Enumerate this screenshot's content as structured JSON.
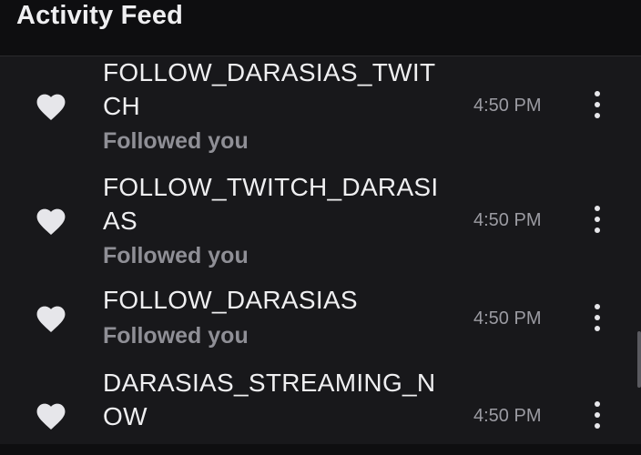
{
  "header": {
    "title": "Activity Feed"
  },
  "icons": {
    "item_icon": "heart-icon",
    "menu_icon": "more-vertical-icon"
  },
  "colors": {
    "background": "#18181b",
    "header_background": "#0e0e10",
    "primary_text": "#efeff1",
    "secondary_text": "#8f8f96",
    "icon": "#e6e6ea"
  },
  "items": [
    {
      "username": "FOLLOW_DARASIAS_TWITCH",
      "subtext": "Followed you",
      "time": "4:50 PM"
    },
    {
      "username": "FOLLOW_TWITCH_DARASIAS",
      "subtext": "Followed you",
      "time": "4:50 PM"
    },
    {
      "username": "FOLLOW_DARASIAS",
      "subtext": "Followed you",
      "time": "4:50 PM"
    },
    {
      "username": "DARASIAS_STREAMING_NOW",
      "subtext": "",
      "time": "4:50 PM"
    }
  ]
}
